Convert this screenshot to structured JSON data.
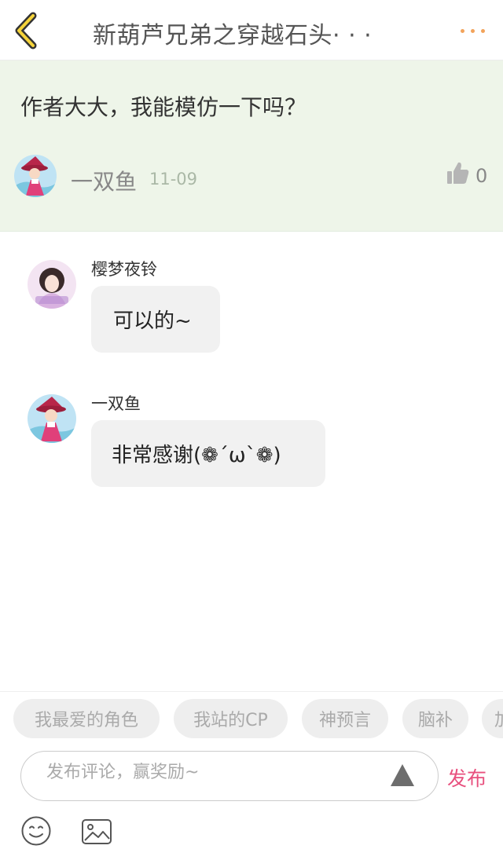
{
  "header": {
    "title": "新葫芦兄弟之穿越石头· · ·",
    "back_icon": "chevron-left-icon",
    "more_icon": "more-dots-icon",
    "accent_color": "#f2a35b"
  },
  "post": {
    "text": "作者大大，我能模仿一下吗？",
    "author": "一双鱼",
    "date": "11-09",
    "likes": "0",
    "like_icon": "thumb-up-icon",
    "background_color": "#eef5e9"
  },
  "replies": [
    {
      "name": "樱梦夜铃",
      "text": "可以的~"
    },
    {
      "name": "一双鱼",
      "text": "非常感谢(❁´ω`❁)"
    }
  ],
  "tags": [
    "我最爱的角色",
    "我站的CP",
    "神预言",
    "脑补",
    "加"
  ],
  "composer": {
    "placeholder": "发布评论，赢奖励~",
    "publish_label": "发布",
    "publish_color": "#e8507e",
    "send_icon": "triangle-icon",
    "emoji_icon": "smiley-icon",
    "image_icon": "image-icon"
  }
}
